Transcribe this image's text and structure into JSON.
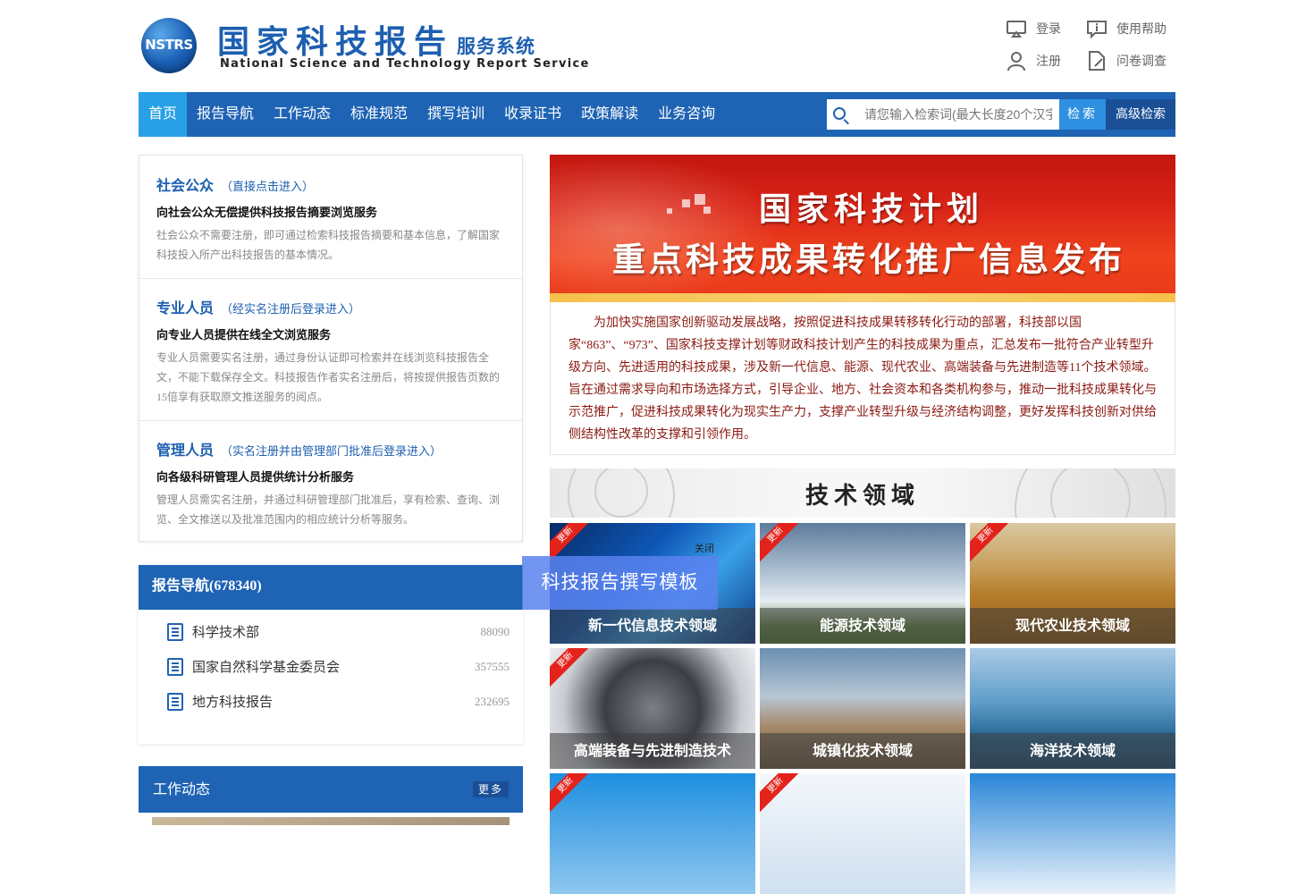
{
  "header": {
    "logo_abbr": "NSTRS",
    "title_cn": "国家科技报告",
    "title_cn_suffix": "服务系统",
    "title_en": "National Science and Technology Report Service",
    "links": {
      "login": "登录",
      "help": "使用帮助",
      "register": "注册",
      "survey": "问卷调查"
    }
  },
  "nav": {
    "items": [
      "首页",
      "报告导航",
      "工作动态",
      "标准规范",
      "撰写培训",
      "收录证书",
      "政策解读",
      "业务咨询"
    ],
    "search_placeholder": "请您输入检索词(最大长度20个汉字)",
    "search_button": "检索",
    "advanced_button": "高级检索"
  },
  "users": [
    {
      "title": "社会公众",
      "note": "（直接点击进入）",
      "subtitle": "向社会公众无偿提供科技报告摘要浏览服务",
      "desc": "社会公众不需要注册，即可通过检索科技报告摘要和基本信息，了解国家科技投入所产出科技报告的基本情况。"
    },
    {
      "title": "专业人员",
      "note": "（经实名注册后登录进入）",
      "subtitle": "向专业人员提供在线全文浏览服务",
      "desc": "专业人员需要实名注册，通过身份认证即可检索并在线浏览科技报告全文，不能下载保存全文。科技报告作者实名注册后，将按提供报告页数的15倍享有获取原文推送服务的阅点。"
    },
    {
      "title": "管理人员",
      "note": "（实名注册并由管理部门批准后登录进入）",
      "subtitle": "向各级科研管理人员提供统计分析服务",
      "desc": "管理人员需实名注册，并通过科研管理部门批准后，享有检索、查询、浏览、全文推送以及批准范围内的相应统计分析等服务。"
    }
  ],
  "report_nav": {
    "title": "报告导航(678340)",
    "rows": [
      {
        "label": "科学技术部",
        "count": "88090"
      },
      {
        "label": "国家自然科学基金委员会",
        "count": "357555"
      },
      {
        "label": "地方科技报告",
        "count": "232695"
      }
    ]
  },
  "work": {
    "title": "工作动态",
    "more": "更多"
  },
  "banner": {
    "line1": "国家科技计划",
    "line2": "重点科技成果转化推广信息发布",
    "intro": "为加快实施国家创新驱动发展战略，按照促进科技成果转移转化行动的部署，科技部以国家“863”、“973”、国家科技支撑计划等财政科技计划产生的科技成果为重点，汇总发布一批符合产业转型升级方向、先进适用的科技成果，涉及新一代信息、能源、现代农业、高端装备与先进制造等11个技术领域。旨在通过需求导向和市场选择方式，引导企业、地方、社会资本和各类机构参与，推动一批科技成果转化与示范推广，促进科技成果转化为现实生产力，支撑产业转型升级与经济结构调整，更好发挥科技创新对供给侧结构性改革的支撑和引领作用。"
  },
  "fields": {
    "title": "技术领域",
    "ribbon": "更新",
    "tiles": [
      {
        "label": "新一代信息技术领域",
        "ribbon": true
      },
      {
        "label": "能源技术领域",
        "ribbon": true
      },
      {
        "label": "现代农业技术领域",
        "ribbon": true
      },
      {
        "label": "高端装备与先进制造技术",
        "ribbon": true
      },
      {
        "label": "城镇化技术领域",
        "ribbon": false
      },
      {
        "label": "海洋技术领域",
        "ribbon": false
      },
      {
        "label": "",
        "ribbon": true
      },
      {
        "label": "",
        "ribbon": true
      },
      {
        "label": "",
        "ribbon": false
      }
    ]
  },
  "popup": {
    "title": "科技报告撰写模板",
    "close": "关闭"
  }
}
